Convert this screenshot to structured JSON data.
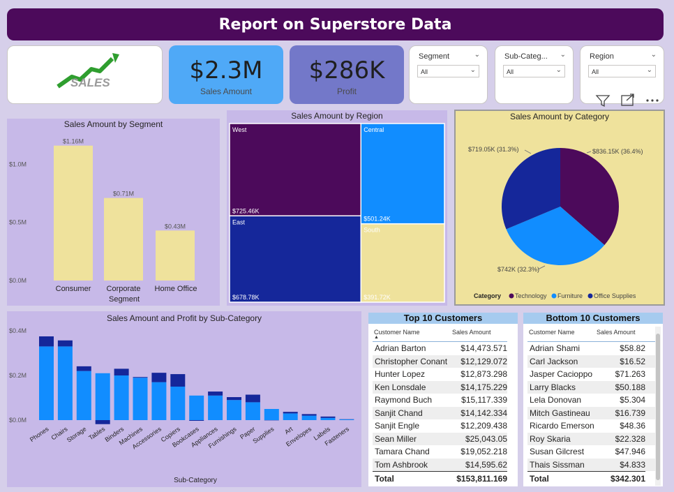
{
  "header": {
    "title": "Report on Superstore Data"
  },
  "logo": {
    "text": "SALES",
    "icon": "growth-arrow-icon"
  },
  "kpis": [
    {
      "value": "$2.3M",
      "label": "Sales Amount",
      "color": "#4fa9f7"
    },
    {
      "value": "$286K",
      "label": "Profit",
      "color": "#7378c9"
    }
  ],
  "slicers": [
    {
      "title": "Segment",
      "value": "All"
    },
    {
      "title": "Sub-Categ...",
      "value": "All"
    },
    {
      "title": "Region",
      "value": "All"
    }
  ],
  "visual_toolbar": {
    "icons": [
      "filter-icon",
      "focus-mode-icon",
      "more-options-icon"
    ]
  },
  "colors": {
    "purple": "#4c0a5b",
    "navy": "#15279a",
    "blue": "#118dff",
    "yellow": "#efe29c",
    "panel": "#c7b9e8"
  },
  "chart_data": [
    {
      "type": "bar",
      "title": "Sales Amount by Segment",
      "xlabel": "Segment",
      "categories": [
        "Consumer",
        "Corporate",
        "Home Office"
      ],
      "values": [
        1.16,
        0.71,
        0.43
      ],
      "data_labels": [
        "$1.16M",
        "$0.71M",
        "$0.43M"
      ],
      "y_ticks": [
        "$1.0M",
        "$0.5M",
        "$0.0M"
      ],
      "ylim": [
        0,
        1.2
      ],
      "color": "#efe29c"
    },
    {
      "type": "treemap",
      "title": "Sales Amount by Region",
      "items": [
        {
          "name": "West",
          "value": 725.46,
          "label": "$725.46K",
          "color": "#4c0a5b"
        },
        {
          "name": "East",
          "value": 678.78,
          "label": "$678.78K",
          "color": "#15279a"
        },
        {
          "name": "Central",
          "value": 501.24,
          "label": "$501.24K",
          "color": "#118dff"
        },
        {
          "name": "South",
          "value": 391.72,
          "label": "$391.72K",
          "color": "#efe29c"
        }
      ]
    },
    {
      "type": "pie",
      "title": "Sales Amount by Category",
      "legend_title": "Category",
      "slices": [
        {
          "name": "Technology",
          "value": 836.15,
          "label": "$836.15K (36.4%)",
          "color": "#4c0a5b"
        },
        {
          "name": "Furniture",
          "value": 742,
          "label": "$742K (32.3%)",
          "color": "#118dff"
        },
        {
          "name": "Office Supplies",
          "value": 719.05,
          "label": "$719.05K (31.3%)",
          "color": "#15279a"
        }
      ]
    },
    {
      "type": "bar",
      "title": "Sales Amount and Profit by Sub-Category",
      "xlabel": "Sub-Category",
      "categories": [
        "Phones",
        "Chairs",
        "Storage",
        "Tables",
        "Binders",
        "Machines",
        "Accessories",
        "Copiers",
        "Bookcases",
        "Appliances",
        "Furnishings",
        "Paper",
        "Supplies",
        "Art",
        "Envelopes",
        "Labels",
        "Fasteners"
      ],
      "series": [
        {
          "name": "Sales Amount",
          "values": [
            0.33,
            0.33,
            0.22,
            0.21,
            0.2,
            0.19,
            0.17,
            0.15,
            0.11,
            0.11,
            0.09,
            0.08,
            0.05,
            0.03,
            0.02,
            0.01,
            0.003
          ],
          "color": "#118dff"
        },
        {
          "name": "Profit",
          "values": [
            0.045,
            0.027,
            0.021,
            -0.018,
            0.03,
            0.003,
            0.042,
            0.056,
            -0.003,
            0.018,
            0.013,
            0.034,
            -0.001,
            0.007,
            0.007,
            0.006,
            0.001
          ],
          "color": "#15279a"
        }
      ],
      "y_ticks": [
        "$0.4M",
        "$0.2M",
        "$0.0M"
      ],
      "ylim": [
        -0.02,
        0.4
      ]
    }
  ],
  "top_customers": {
    "title": "Top 10 Customers",
    "col_name": "Customer Name",
    "col_value": "Sales Amount",
    "rows": [
      {
        "name": "Adrian Barton",
        "value": "$14,473.571"
      },
      {
        "name": "Christopher Conant",
        "value": "$12,129.072"
      },
      {
        "name": "Hunter Lopez",
        "value": "$12,873.298"
      },
      {
        "name": "Ken Lonsdale",
        "value": "$14,175.229"
      },
      {
        "name": "Raymond Buch",
        "value": "$15,117.339"
      },
      {
        "name": "Sanjit Chand",
        "value": "$14,142.334"
      },
      {
        "name": "Sanjit Engle",
        "value": "$12,209.438"
      },
      {
        "name": "Sean Miller",
        "value": "$25,043.05"
      },
      {
        "name": "Tamara Chand",
        "value": "$19,052.218"
      },
      {
        "name": "Tom Ashbrook",
        "value": "$14,595.62"
      }
    ],
    "total_label": "Total",
    "total_value": "$153,811.169"
  },
  "bottom_customers": {
    "title": "Bottom 10 Customers",
    "col_name": "Customer Name",
    "col_value": "Sales Amount",
    "rows": [
      {
        "name": "Adrian Shami",
        "value": "$58.82"
      },
      {
        "name": "Carl Jackson",
        "value": "$16.52"
      },
      {
        "name": "Jasper Cacioppo",
        "value": "$71.263"
      },
      {
        "name": "Larry Blacks",
        "value": "$50.188"
      },
      {
        "name": "Lela Donovan",
        "value": "$5.304"
      },
      {
        "name": "Mitch Gastineau",
        "value": "$16.739"
      },
      {
        "name": "Ricardo Emerson",
        "value": "$48.36"
      },
      {
        "name": "Roy Skaria",
        "value": "$22.328"
      },
      {
        "name": "Susan Gilcrest",
        "value": "$47.946"
      },
      {
        "name": "Thais Sissman",
        "value": "$4.833"
      }
    ],
    "total_label": "Total",
    "total_value": "$342.301"
  }
}
